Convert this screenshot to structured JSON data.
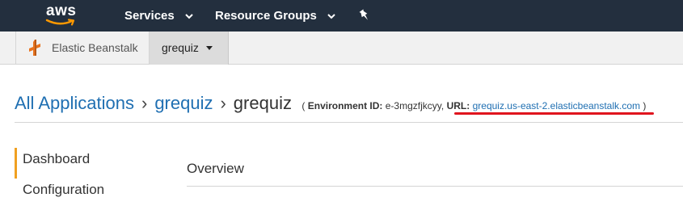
{
  "topnav": {
    "logo_text": "aws",
    "services_label": "Services",
    "resource_groups_label": "Resource Groups",
    "pin_icon": "pin-icon",
    "background": "#232f3e"
  },
  "subnav": {
    "service_label": "Elastic Beanstalk",
    "service_icon": "elastic-beanstalk-icon",
    "app_dropdown_label": "grequiz"
  },
  "breadcrumb": {
    "all_apps": "All Applications",
    "app": "grequiz",
    "environment": "grequiz",
    "env_id_label": "Environment ID:",
    "env_id_value": "e-3mgzfjkcyy,",
    "url_label": "URL:",
    "url_value": "grequiz.us-east-2.elasticbeanstalk.com",
    "open_paren": "(",
    "close_paren": ")"
  },
  "sidebar": {
    "items": [
      {
        "label": "Dashboard",
        "active": true
      },
      {
        "label": "Configuration",
        "active": false
      }
    ]
  },
  "main": {
    "section_title": "Overview"
  },
  "colors": {
    "link": "#1f6fb2",
    "highlight_underline": "#e0141e",
    "active_marker": "#f0a020"
  }
}
